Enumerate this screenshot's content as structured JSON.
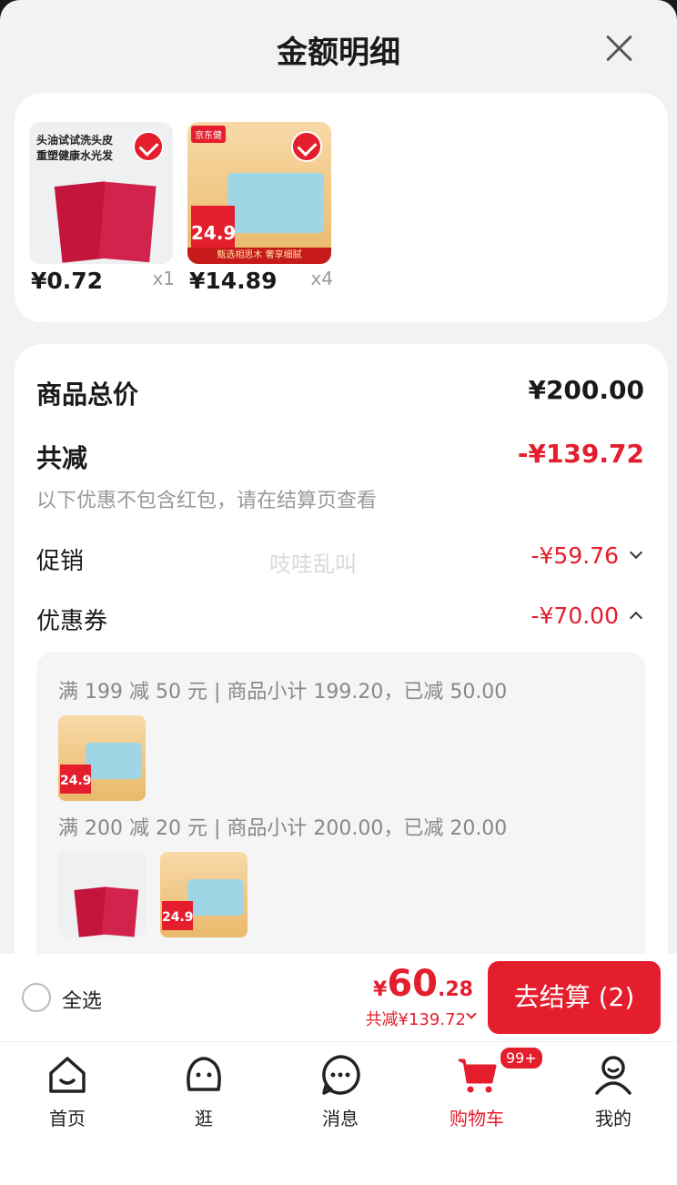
{
  "sheet": {
    "title": "金额明细"
  },
  "products": [
    {
      "price": "¥0.72",
      "qty": "x1",
      "thumb_text": "头油试试洗头皮\n重塑健康水光发"
    },
    {
      "price": "¥14.89",
      "qty": "x4",
      "thumb_logo": "京东健",
      "thumb_price": "24.9",
      "thumb_banner": "甄选相思木 奢享细腻"
    }
  ],
  "summary": {
    "total_label": "商品总价",
    "total_value": "¥200.00",
    "saved_label": "共减",
    "saved_value": "-¥139.72",
    "note": "以下优惠不包含红包，请在结算页查看",
    "promo_label": "促销",
    "promo_value": "-¥59.76",
    "coupon_label": "优惠券",
    "coupon_value": "-¥70.00",
    "watermark": "吱哇乱叫"
  },
  "coupons": [
    {
      "text": "满 199 减 50 元 | 商品小计 199.20，已减 50.00"
    },
    {
      "text": "满 200 减 20 元 | 商品小计 200.00，已减 20.00"
    }
  ],
  "footer": {
    "select_all": "全选",
    "currency": "¥",
    "total_int": "60",
    "total_dec": ".28",
    "saved": "共减¥139.72",
    "checkout": "去结算 (2)"
  },
  "tabs": [
    {
      "label": "首页",
      "icon": "home-icon"
    },
    {
      "label": "逛",
      "icon": "explore-icon"
    },
    {
      "label": "消息",
      "icon": "message-icon"
    },
    {
      "label": "购物车",
      "icon": "cart-icon",
      "badge": "99+",
      "active": true
    },
    {
      "label": "我的",
      "icon": "profile-icon"
    }
  ],
  "colors": {
    "accent": "#e41e2d",
    "background": "#f2f2f2"
  }
}
